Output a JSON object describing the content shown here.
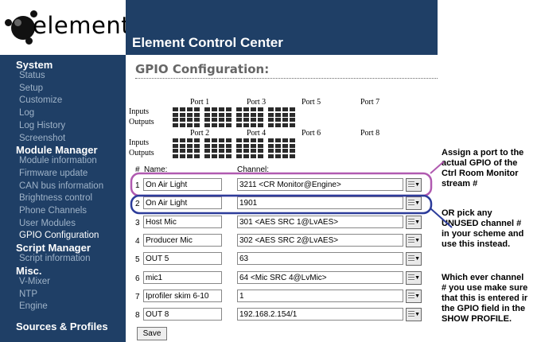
{
  "logo": {
    "text": "element"
  },
  "header": {
    "title": "Element Control Center"
  },
  "sidebar": {
    "system": {
      "title": "System",
      "items": [
        "Status",
        "Setup",
        "Customize",
        "Log",
        "Log History",
        "Screenshot"
      ]
    },
    "module_manager": {
      "title": "Module Manager",
      "items": [
        "Module information",
        "Firmware update",
        "CAN bus information",
        "Brightness control",
        "Phone Channels",
        "User Modules",
        "GPIO Configuration"
      ]
    },
    "script_manager": {
      "title": "Script Manager",
      "items": [
        "Script information"
      ]
    },
    "misc": {
      "title": "Misc.",
      "items": [
        "V-Mixer",
        "NTP",
        "Engine"
      ]
    },
    "sources": {
      "title": "Sources & Profiles"
    }
  },
  "page": {
    "title": "GPIO Configuration:",
    "ports_top": [
      "Port 1",
      "Port 3",
      "Port 5",
      "Port 7"
    ],
    "ports_bottom": [
      "Port 2",
      "Port 4",
      "Port 6",
      "Port 8"
    ],
    "inputs_label": "Inputs",
    "outputs_label": "Outputs",
    "col_num": "#",
    "col_name": "Name:",
    "col_channel": "Channel:",
    "rows": [
      {
        "num": "1",
        "name": "On Air Light",
        "channel": "3211 <CR Monitor@Engine>"
      },
      {
        "num": "2",
        "name": "On Air Light",
        "channel": "1901"
      },
      {
        "num": "3",
        "name": "Host Mic",
        "channel": "301 <AES SRC 1@LvAES>"
      },
      {
        "num": "4",
        "name": "Producer Mic",
        "channel": "302 <AES SRC 2@LvAES>"
      },
      {
        "num": "5",
        "name": "OUT 5",
        "channel": "63"
      },
      {
        "num": "6",
        "name": "mic1",
        "channel": "64 <Mic SRC 4@LvMic>"
      },
      {
        "num": "7",
        "name": "Iprofiler skim 6-10",
        "channel": "1"
      },
      {
        "num": "8",
        "name": "OUT 8",
        "channel": "192.168.2.154/1"
      }
    ],
    "save_label": "Save"
  },
  "annotations": {
    "note1": [
      "Assign a port to the",
      "actual GPIO of the",
      "Ctrl Room Monitor",
      "stream #"
    ],
    "note2": [
      "OR pick any",
      "UNUSED channel #",
      "in your scheme and",
      "use this instead."
    ],
    "note3": [
      "Which ever channel",
      "# you use make sure",
      "that this is entered ir",
      "the GPIO field in the",
      "SHOW PROFILE."
    ]
  },
  "colors": {
    "nav_bg": "#1f3f66",
    "highlight_purple": "#b05ab0",
    "highlight_blue": "#2c3c9a"
  }
}
